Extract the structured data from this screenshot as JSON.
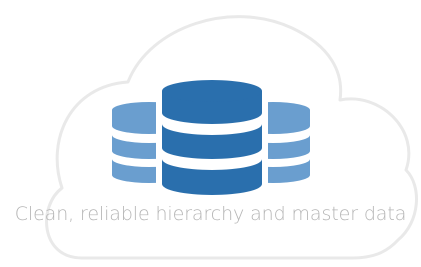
{
  "tagline": "Clean, reliable hierarchy and master data",
  "icons": {
    "cloud": "cloud-icon",
    "database": "database-stack-icon"
  },
  "colors": {
    "cloud_outline": "#e9e9e9",
    "primary_database": "#2a6fad",
    "secondary_database": "#6a9ecf",
    "text": "#b5b5b5",
    "background": "#ffffff"
  }
}
